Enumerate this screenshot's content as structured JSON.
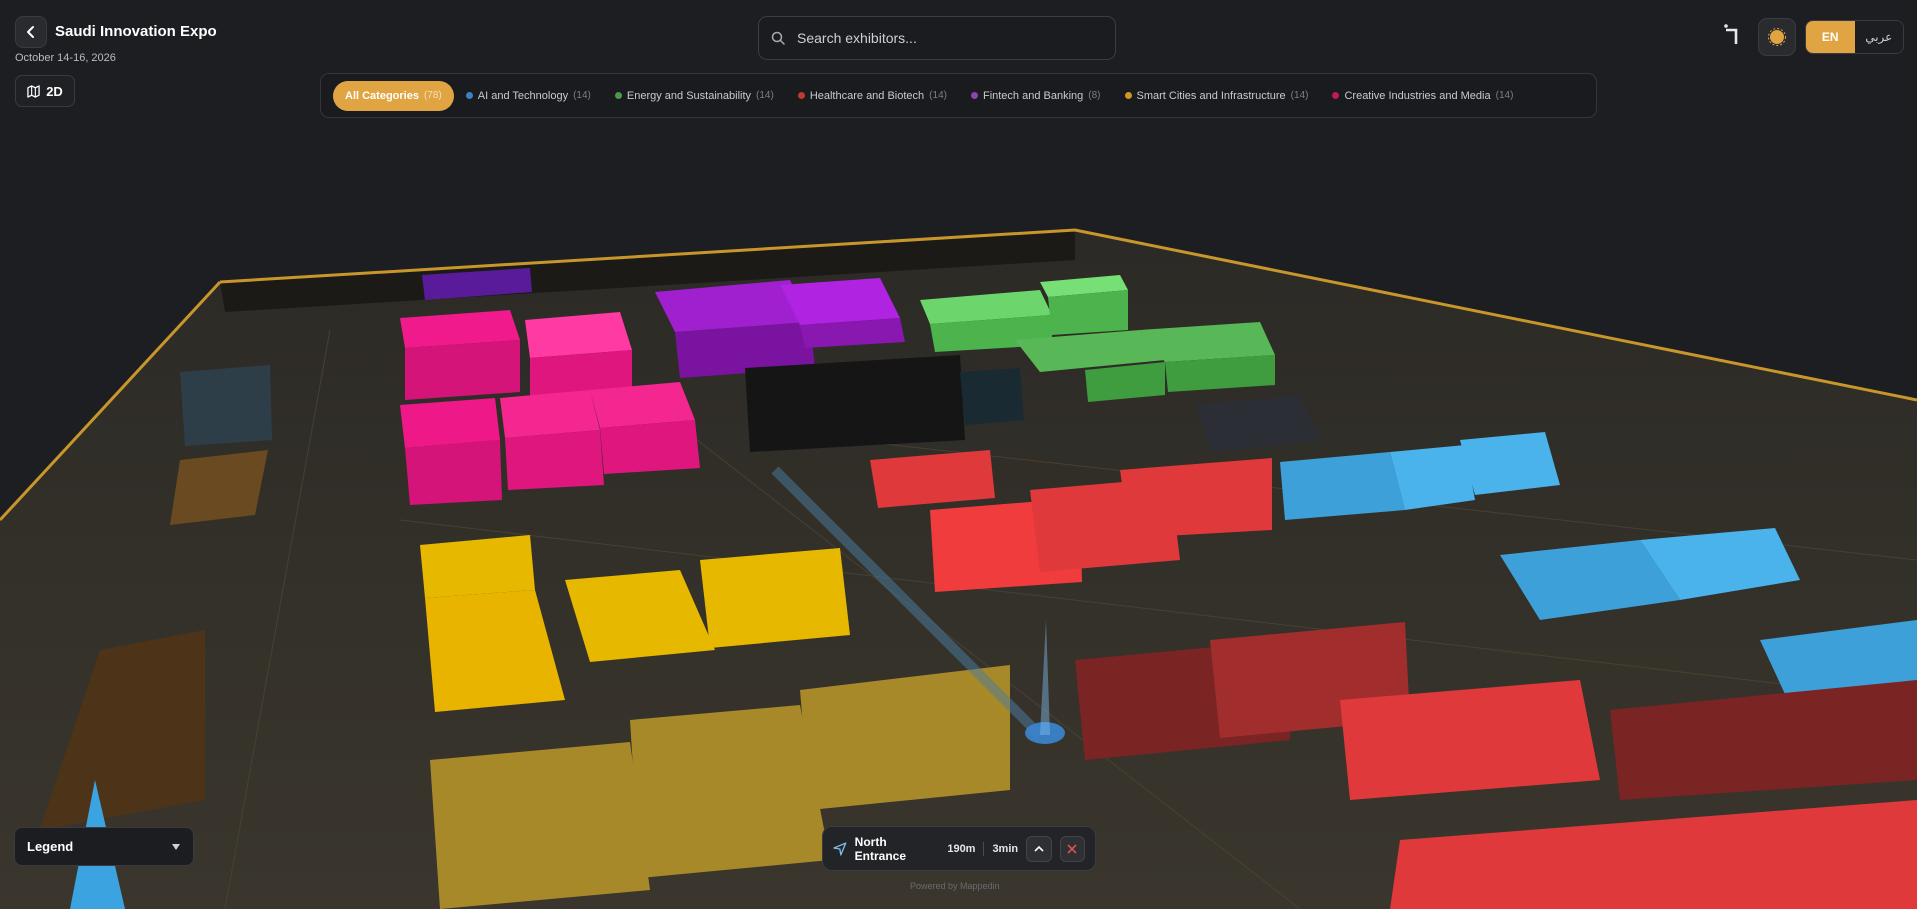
{
  "header": {
    "title": "Saudi Innovation Expo",
    "date": "October 14-16, 2026",
    "view_toggle": "2D"
  },
  "search": {
    "placeholder": "Search exhibitors..."
  },
  "categories": [
    {
      "label": "All Categories",
      "count": "(78)",
      "color": "#e0a442",
      "active": true
    },
    {
      "label": "AI and Technology",
      "count": "(14)",
      "color": "#3b82c4"
    },
    {
      "label": "Energy and Sustainability",
      "count": "(14)",
      "color": "#4a9a4a"
    },
    {
      "label": "Healthcare and Biotech",
      "count": "(14)",
      "color": "#c0392b"
    },
    {
      "label": "Fintech and Banking",
      "count": "(8)",
      "color": "#8e44ad"
    },
    {
      "label": "Smart Cities and Infrastructure",
      "count": "(14)",
      "color": "#c99a1c"
    },
    {
      "label": "Creative Industries and Media",
      "count": "(14)",
      "color": "#c2185b"
    }
  ],
  "language": {
    "active": "EN",
    "other": "عربي"
  },
  "legend": {
    "label": "Legend"
  },
  "navigation": {
    "destination": "North Entrance",
    "distance": "190m",
    "time": "3min"
  },
  "footer": {
    "powered": "Powered by Mappedin"
  },
  "colors": {
    "accent": "#e0a442",
    "ai_booth": "#4ea8d8",
    "energy_booth": "#5cc45c",
    "healthcare_booth": "#e0393b",
    "fintech_booth": "#9b1fc1",
    "smart_city_booth": "#e6b800",
    "creative_booth": "#e6127f"
  },
  "icons": [
    "back-arrow-icon",
    "map-icon",
    "search-icon",
    "logo-icon",
    "sun-icon",
    "chevron-down-icon",
    "navigation-icon",
    "chevron-up-icon",
    "close-icon"
  ]
}
